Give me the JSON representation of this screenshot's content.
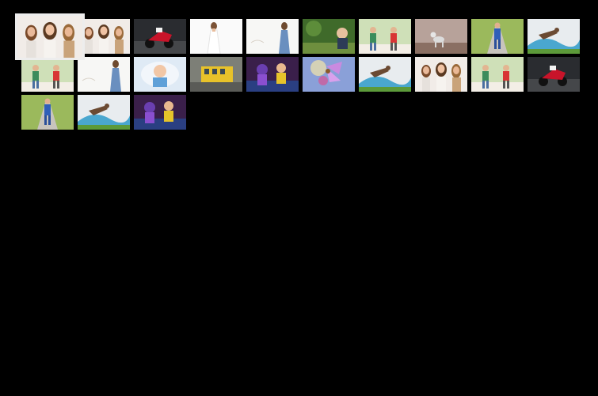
{
  "gallery": {
    "selected_index": 0,
    "thumbnails": [
      {
        "subject": "three-girls-portrait",
        "theme": "girls"
      },
      {
        "subject": "three-girls-portrait",
        "theme": "girls"
      },
      {
        "subject": "motorcycle-racer",
        "theme": "moto"
      },
      {
        "subject": "woman-white-dress",
        "theme": "dress"
      },
      {
        "subject": "woman-blue-dress",
        "theme": "dressblue"
      },
      {
        "subject": "child-in-park",
        "theme": "park"
      },
      {
        "subject": "kids-playing-outdoors",
        "theme": "kids"
      },
      {
        "subject": "cat-in-room",
        "theme": "cat"
      },
      {
        "subject": "runner-on-road",
        "theme": "runner"
      },
      {
        "subject": "dog-jumping-sky",
        "theme": "dog"
      },
      {
        "subject": "kids-playing-outdoors",
        "theme": "kids"
      },
      {
        "subject": "woman-blue-dress",
        "theme": "dressblue"
      },
      {
        "subject": "baby-portrait",
        "theme": "baby"
      },
      {
        "subject": "tram-street",
        "theme": "tram"
      },
      {
        "subject": "children-purple-costume",
        "theme": "costume"
      },
      {
        "subject": "fairy-fantasy",
        "theme": "fairy"
      },
      {
        "subject": "dog-jumping-sky",
        "theme": "dog"
      },
      {
        "subject": "three-girls-portrait",
        "theme": "girls"
      },
      {
        "subject": "kids-playing-outdoors",
        "theme": "kids"
      },
      {
        "subject": "motorcycle-racer",
        "theme": "moto"
      },
      {
        "subject": "runner-on-road",
        "theme": "runner"
      },
      {
        "subject": "dog-jumping-sky",
        "theme": "dog"
      },
      {
        "subject": "children-purple-costume",
        "theme": "costume"
      }
    ]
  },
  "colors": {
    "background": "#000000",
    "selection_frame": "#ededed"
  }
}
